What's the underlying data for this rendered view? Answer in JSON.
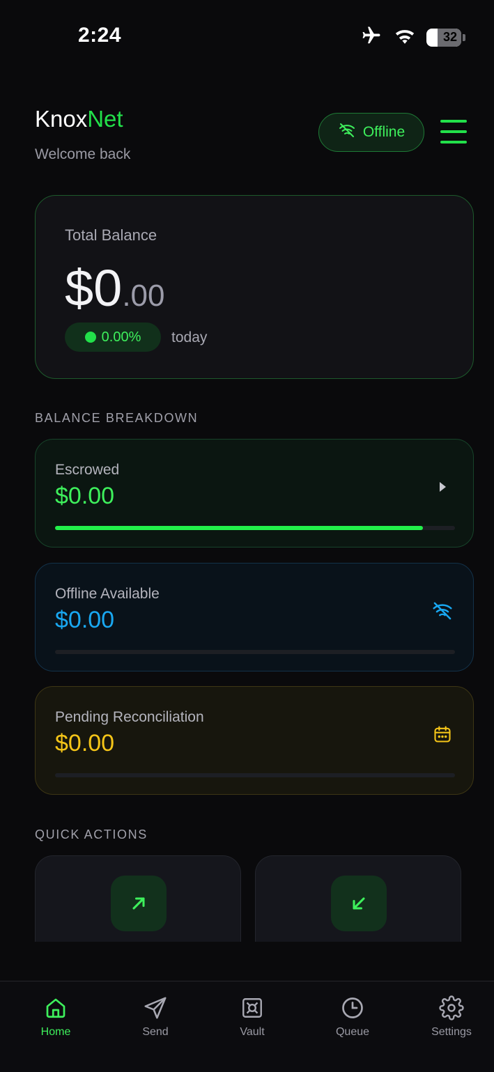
{
  "status_bar": {
    "time": "2:24",
    "battery_level": "32"
  },
  "header": {
    "brand_prefix": "Knox",
    "brand_accent": "Net",
    "welcome": "Welcome back",
    "offline_label": "Offline"
  },
  "balance": {
    "label": "Total Balance",
    "amount_major": "$0",
    "amount_minor": ".00",
    "change": "0.00%",
    "change_suffix": "today"
  },
  "breakdown": {
    "title": "BALANCE BREAKDOWN",
    "escrowed": {
      "label": "Escrowed",
      "amount": "$0.00",
      "progress": 0.92
    },
    "offline_available": {
      "label": "Offline Available",
      "amount": "$0.00",
      "progress": 0
    },
    "pending": {
      "label": "Pending Reconciliation",
      "amount": "$0.00",
      "progress": 0
    }
  },
  "quick_actions": {
    "title": "QUICK ACTIONS"
  },
  "tabs": [
    {
      "label": "Home"
    },
    {
      "label": "Send"
    },
    {
      "label": "Vault"
    },
    {
      "label": "Queue"
    },
    {
      "label": "Settings"
    }
  ],
  "colors": {
    "accent_green": "#22e04a",
    "accent_blue": "#19a8f2",
    "accent_yellow": "#f5c518",
    "background": "#0a0a0c"
  }
}
